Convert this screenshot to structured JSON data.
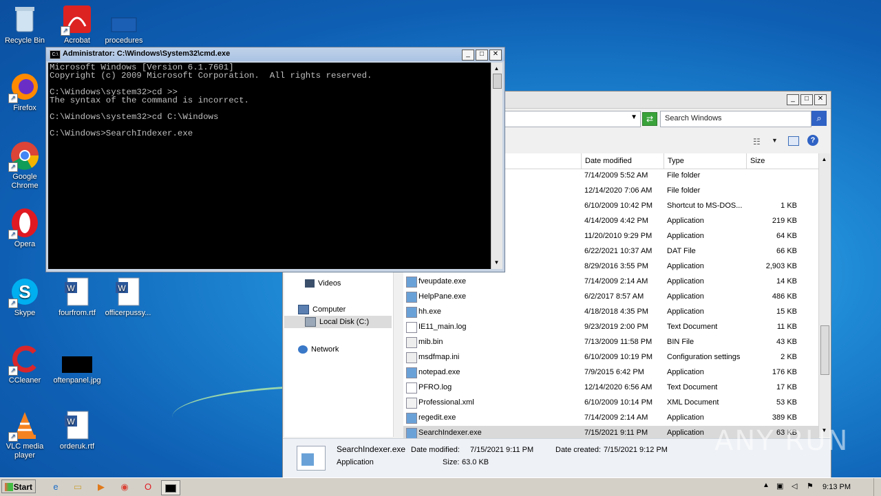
{
  "desktop": {
    "icons": [
      {
        "label": "Recycle Bin",
        "icon": "recycle-bin-icon"
      },
      {
        "label": "Acrobat",
        "icon": "acrobat-icon"
      },
      {
        "label": "procedures",
        "icon": "file-icon"
      },
      {
        "label": "Firefox",
        "icon": "firefox-icon"
      },
      {
        "label": "Google Chrome",
        "icon": "chrome-icon"
      },
      {
        "label": "Opera",
        "icon": "opera-icon"
      },
      {
        "label": "Skype",
        "icon": "skype-icon"
      },
      {
        "label": "fourfrom.rtf",
        "icon": "word-doc-icon"
      },
      {
        "label": "officerpussy...",
        "icon": "word-doc-icon"
      },
      {
        "label": "CCleaner",
        "icon": "ccleaner-icon"
      },
      {
        "label": "oftenpanel.jpg",
        "icon": "image-icon"
      },
      {
        "label": "VLC media player",
        "icon": "vlc-icon"
      },
      {
        "label": "orderuk.rtf",
        "icon": "word-doc-icon"
      }
    ]
  },
  "cmd": {
    "title": "Administrator: C:\\Windows\\System32\\cmd.exe",
    "icon_text": "C:\\",
    "lines": [
      "Microsoft Windows [Version 6.1.7601]",
      "Copyright (c) 2009 Microsoft Corporation.  All rights reserved.",
      "",
      "C:\\Windows\\system32>cd >>",
      "The syntax of the command is incorrect.",
      "",
      "C:\\Windows\\system32>cd C:\\Windows",
      "",
      "C:\\Windows>SearchIndexer.exe"
    ]
  },
  "explorer": {
    "search_placeholder": "Search Windows",
    "columns": {
      "date": "Date modified",
      "type": "Type",
      "size": "Size"
    },
    "nav": [
      {
        "label": "Videos",
        "icon": "videos-icon"
      },
      {
        "label": "Computer",
        "icon": "computer-icon"
      },
      {
        "label": "Local Disk (C:)",
        "icon": "disk-icon"
      },
      {
        "label": "Network",
        "icon": "network-icon"
      }
    ],
    "rows": [
      {
        "name": "",
        "date": "7/14/2009 5:52 AM",
        "type": "File folder",
        "size": ""
      },
      {
        "name": "",
        "date": "12/14/2020 7:06 AM",
        "type": "File folder",
        "size": ""
      },
      {
        "name": "",
        "date": "6/10/2009 10:42 PM",
        "type": "Shortcut to MS-DOS...",
        "size": "1 KB"
      },
      {
        "name": "",
        "date": "4/14/2009 4:42 PM",
        "type": "Application",
        "size": "219 KB"
      },
      {
        "name": "",
        "date": "11/20/2010 9:29 PM",
        "type": "Application",
        "size": "64 KB"
      },
      {
        "name": "",
        "date": "6/22/2021 10:37 AM",
        "type": "DAT File",
        "size": "66 KB"
      },
      {
        "name": "",
        "date": "8/29/2016 3:55 PM",
        "type": "Application",
        "size": "2,903 KB"
      },
      {
        "name": "fveupdate.exe",
        "date": "7/14/2009 2:14 AM",
        "type": "Application",
        "size": "14 KB"
      },
      {
        "name": "HelpPane.exe",
        "date": "6/2/2017 8:57 AM",
        "type": "Application",
        "size": "486 KB"
      },
      {
        "name": "hh.exe",
        "date": "4/18/2018 4:35 PM",
        "type": "Application",
        "size": "15 KB"
      },
      {
        "name": "IE11_main.log",
        "date": "9/23/2019 2:00 PM",
        "type": "Text Document",
        "size": "11 KB"
      },
      {
        "name": "mib.bin",
        "date": "7/13/2009 11:58 PM",
        "type": "BIN File",
        "size": "43 KB"
      },
      {
        "name": "msdfmap.ini",
        "date": "6/10/2009 10:19 PM",
        "type": "Configuration settings",
        "size": "2 KB"
      },
      {
        "name": "notepad.exe",
        "date": "7/9/2015 6:42 PM",
        "type": "Application",
        "size": "176 KB"
      },
      {
        "name": "PFRO.log",
        "date": "12/14/2020 6:56 AM",
        "type": "Text Document",
        "size": "17 KB"
      },
      {
        "name": "Professional.xml",
        "date": "6/10/2009 10:14 PM",
        "type": "XML Document",
        "size": "53 KB"
      },
      {
        "name": "regedit.exe",
        "date": "7/14/2009 2:14 AM",
        "type": "Application",
        "size": "389 KB"
      },
      {
        "name": "SearchIndexer.exe",
        "date": "7/15/2021 9:11 PM",
        "type": "Application",
        "size": "63 KB"
      }
    ],
    "details": {
      "name": "SearchIndexer.exe",
      "type": "Application",
      "modified_label": "Date modified:",
      "modified": "7/15/2021 9:11 PM",
      "created_label": "Date created:",
      "created": "7/15/2021 9:12 PM",
      "size_label": "Size:",
      "size": "63.0 KB"
    }
  },
  "taskbar": {
    "start_label": "Start",
    "clock": "9:13 PM"
  },
  "watermark": "ANY RUN"
}
